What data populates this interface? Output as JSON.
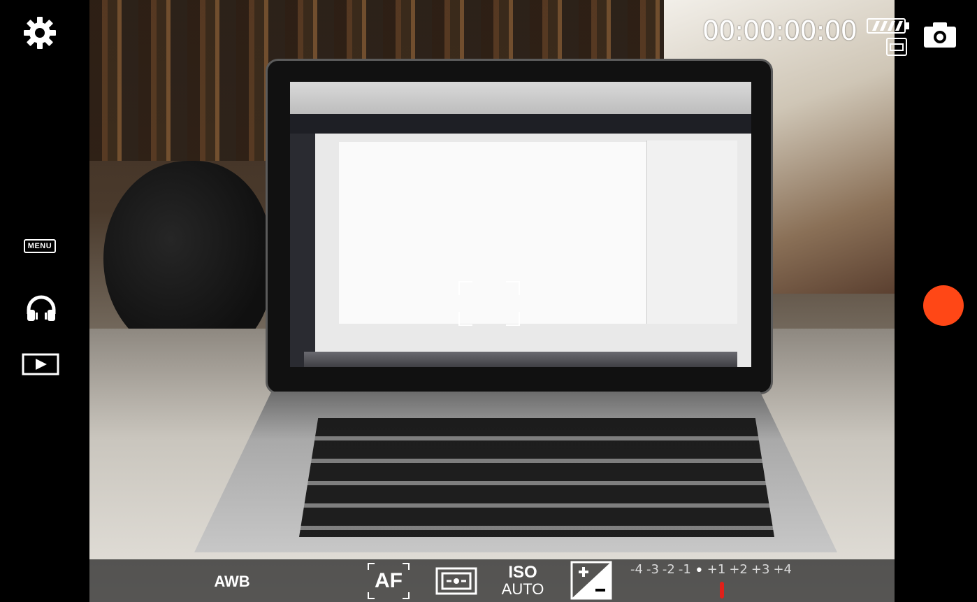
{
  "recording": {
    "timecode": "00:00:00:00"
  },
  "left_rail": {
    "menu_label": "MENU"
  },
  "bottom_bar": {
    "awb_label": "AWB",
    "af_label": "AF",
    "iso_label": "ISO",
    "iso_value": "AUTO",
    "ev_scale": [
      "-4",
      "-3",
      "-2",
      "-1",
      "•",
      "+1",
      "+2",
      "+3",
      "+4"
    ],
    "ev_selected": "0"
  },
  "colors": {
    "record_button": "#ff4716",
    "ev_marker": "#e0201a"
  },
  "icons": {
    "settings": "gear-icon",
    "audio": "headphones-icon",
    "playback": "play-icon",
    "photo": "camera-icon",
    "battery": "battery-icon",
    "storage": "sd-card-icon",
    "metering": "metering-icon",
    "exposure": "exposure-compensation-icon"
  }
}
